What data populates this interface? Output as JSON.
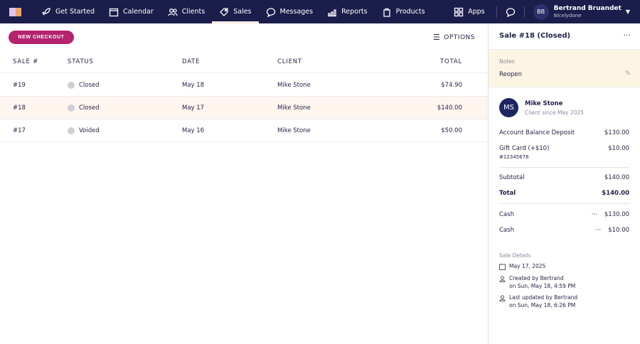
{
  "colors": {
    "nav": "#1b1e4b",
    "accent": "#b4236d",
    "selected_row": "#fdf5ee",
    "notes_bg": "#fcf5e3"
  },
  "nav": {
    "items": [
      {
        "label": "Get Started",
        "icon": "rocket-icon"
      },
      {
        "label": "Calendar",
        "icon": "calendar-icon"
      },
      {
        "label": "Clients",
        "icon": "users-icon"
      },
      {
        "label": "Sales",
        "icon": "tag-icon",
        "active": true
      },
      {
        "label": "Messages",
        "icon": "chat-icon"
      },
      {
        "label": "Reports",
        "icon": "chart-icon"
      },
      {
        "label": "Products",
        "icon": "bag-icon"
      }
    ],
    "apps": "Apps",
    "user": {
      "initials": "BB",
      "name": "Bertrand Bruandet",
      "business": "Nicelydone"
    }
  },
  "toolbar": {
    "new_checkout": "NEW CHECKOUT",
    "options": "OPTIONS"
  },
  "table": {
    "headers": [
      "SALE #",
      "STATUS",
      "DATE",
      "CLIENT",
      "TOTAL"
    ],
    "rows": [
      {
        "sale": "#19",
        "status": "Closed",
        "date": "May 18",
        "client": "Mike Stone",
        "total": "$74.90"
      },
      {
        "sale": "#18",
        "status": "Closed",
        "date": "May 17",
        "client": "Mike Stone",
        "total": "$140.00",
        "selected": true
      },
      {
        "sale": "#17",
        "status": "Voided",
        "date": "May 16",
        "client": "Mike Stone",
        "total": "$50.00"
      }
    ]
  },
  "detail": {
    "title": "Sale #18 (Closed)",
    "notes_label": "Notes",
    "notes": "Reopen",
    "client": {
      "initials": "MS",
      "name": "Mike Stone",
      "since": "Client since May 2025"
    },
    "items": [
      {
        "label": "Account Balance Deposit",
        "amount": "$130.00"
      },
      {
        "label": "Gift Card (+$10)",
        "sub": "#12345678",
        "amount": "$10.00"
      }
    ],
    "subtotal_label": "Subtotal",
    "subtotal": "$140.00",
    "total_label": "Total",
    "total": "$140.00",
    "payments": [
      {
        "label": "Cash",
        "amount": "$130.00"
      },
      {
        "label": "Cash",
        "amount": "$10.00"
      }
    ],
    "details_label": "Sale Details",
    "date": "May 17, 2025",
    "created": "Created by Bertrand",
    "created_on": "on Sun, May 18, 4:59 PM",
    "updated": "Last updated by Bertrand",
    "updated_on": "on Sun, May 18, 6:26 PM"
  }
}
